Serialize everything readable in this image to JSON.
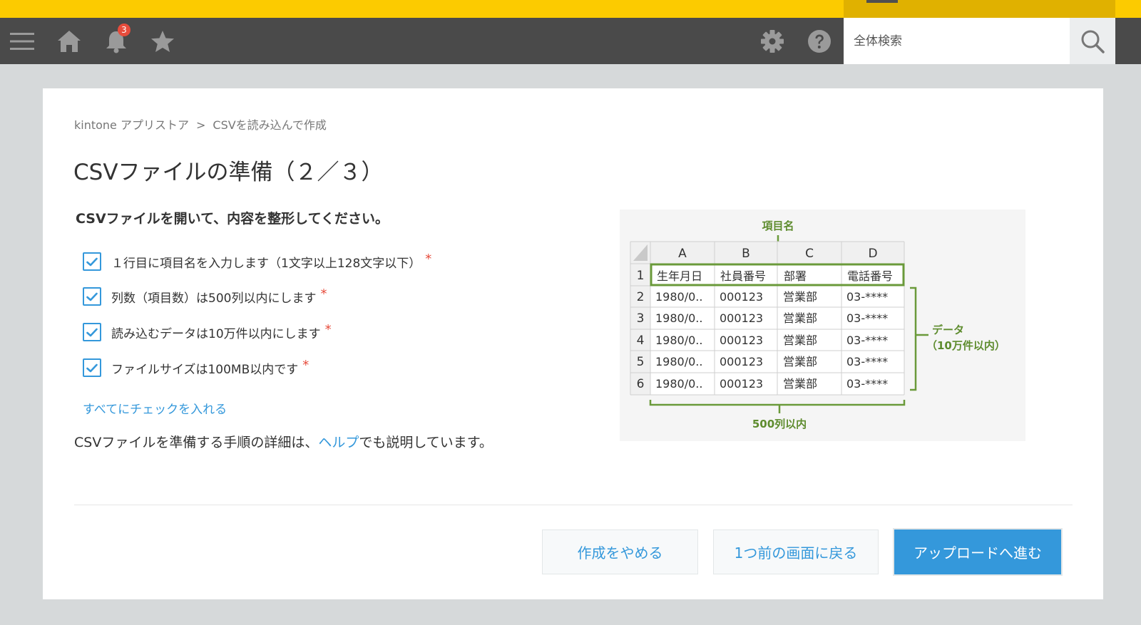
{
  "header": {
    "notification_count": "3",
    "search_placeholder": "全体検索"
  },
  "breadcrumb": {
    "root": "kintone アプリストア",
    "separator": ">",
    "current": "CSVを読み込んで作成"
  },
  "page": {
    "title": "CSVファイルの準備（２／３）",
    "lead": "CSVファイルを開いて、内容を整形してください。"
  },
  "checklist": [
    {
      "label": "１行目に項目名を入力します（1文字以上128文字以下）",
      "checked": true,
      "required": "*"
    },
    {
      "label": "列数（項目数）は500列以内にします",
      "checked": true,
      "required": "*"
    },
    {
      "label": "読み込むデータは10万件以内にします",
      "checked": true,
      "required": "*"
    },
    {
      "label": "ファイルサイズは100MB以内です",
      "checked": true,
      "required": "*"
    }
  ],
  "check_all_link": "すべてにチェックを入れる",
  "help": {
    "prefix": "CSVファイルを準備する手順の詳細は、",
    "link": "ヘルプ",
    "suffix": "でも説明しています。"
  },
  "illustration": {
    "header_label": "項目名",
    "data_label_1": "データ",
    "data_label_2": "（10万件以内）",
    "columns_label": "500列以内",
    "col_letters": [
      "A",
      "B",
      "C",
      "D"
    ],
    "row_numbers": [
      "1",
      "2",
      "3",
      "4",
      "5",
      "6"
    ],
    "header_row": [
      "生年月日",
      "社員番号",
      "部署",
      "電話番号"
    ],
    "data_rows": [
      [
        "1980/0..",
        "000123",
        "営業部",
        "03-****"
      ],
      [
        "1980/0..",
        "000123",
        "営業部",
        "03-****"
      ],
      [
        "1980/0..",
        "000123",
        "営業部",
        "03-****"
      ],
      [
        "1980/0..",
        "000123",
        "営業部",
        "03-****"
      ],
      [
        "1980/0..",
        "000123",
        "営業部",
        "03-****"
      ]
    ]
  },
  "buttons": {
    "cancel": "作成をやめる",
    "back": "1つ前の画面に戻る",
    "next": "アップロードへ進む"
  },
  "colors": {
    "accent_yellow": "#fccb00",
    "nav_bg": "#4a4a4a",
    "link_blue": "#3498db",
    "required_red": "#e74c3c",
    "illustration_green": "#6a9a3a"
  }
}
